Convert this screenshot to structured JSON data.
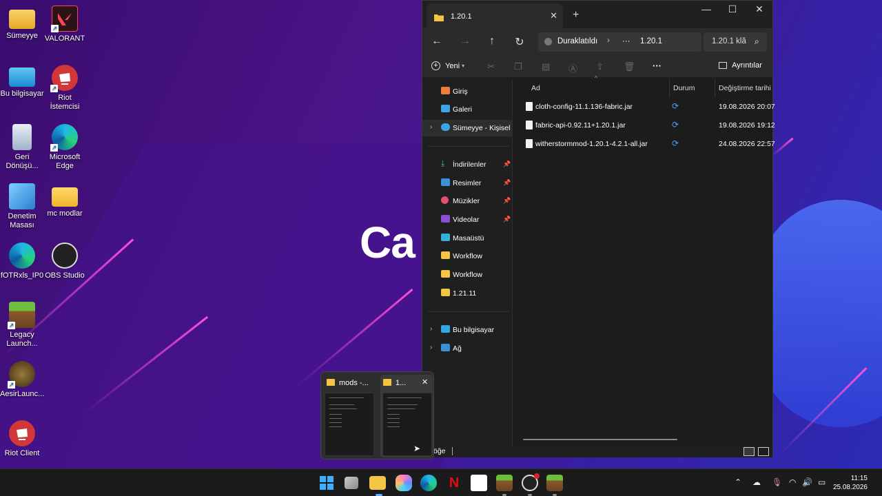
{
  "desktop": {
    "icons": [
      {
        "label": "Sümeyye"
      },
      {
        "label": "VALORANT"
      },
      {
        "label": "Bu bilgisayar"
      },
      {
        "label": "Riot İstemcisi"
      },
      {
        "label": "Geri Dönüşü..."
      },
      {
        "label": "Microsoft Edge"
      },
      {
        "label": "Denetim Masası"
      },
      {
        "label": "mc modlar"
      },
      {
        "label": "fOTRxls_IP0"
      },
      {
        "label": "OBS Studio"
      },
      {
        "label": "Legacy Launch..."
      },
      {
        "label": "AesirLaunc..."
      },
      {
        "label": "Riot Client"
      }
    ],
    "overlay_text": "Ca"
  },
  "explorer": {
    "tab_label": "1.20.1",
    "nav": {
      "address_prefix": "Duraklatıldı",
      "address_ellipsis": "···",
      "address_current": "1.20.1",
      "search_placeholder": "1.20.1 klă"
    },
    "toolbar": {
      "new_label": "Yeni",
      "more_label": "···",
      "details_label": "Ayrıntılar"
    },
    "sidebar": {
      "items": [
        {
          "label": "Giriş",
          "icon": "home-icon"
        },
        {
          "label": "Galeri",
          "icon": "gallery-icon"
        },
        {
          "label": "Sümeyye - Kişisel",
          "icon": "cloud-icon"
        },
        {
          "label": "İndirilenler",
          "icon": "download-icon"
        },
        {
          "label": "Resimler",
          "icon": "pictures-icon"
        },
        {
          "label": "Müzikler",
          "icon": "music-icon"
        },
        {
          "label": "Videolar",
          "icon": "video-icon"
        },
        {
          "label": "Masaüstü",
          "icon": "desktop-icon"
        },
        {
          "label": "Workflow",
          "icon": "folder-icon"
        },
        {
          "label": "Workflow",
          "icon": "folder-icon"
        },
        {
          "label": "1.21.11",
          "icon": "folder-icon"
        },
        {
          "label": "Bu bilgisayar",
          "icon": "computer-icon"
        },
        {
          "label": "Ağ",
          "icon": "network-icon"
        }
      ]
    },
    "columns": {
      "name": "Ad",
      "status": "Durum",
      "modified": "Değiştirme tarihi"
    },
    "files": [
      {
        "name": "cloth-config-11.1.136-fabric.jar",
        "date": "19.08.2026 20:07"
      },
      {
        "name": "fabric-api-0.92.11+1.20.1.jar",
        "date": "19.08.2026 19:12"
      },
      {
        "name": "witherstormmod-1.20.1-4.2.1-all.jar",
        "date": "24.08.2026 22:57"
      }
    ],
    "statusbar_text": "öğe"
  },
  "preview": {
    "items": [
      {
        "label": "mods -..."
      },
      {
        "label": "1..."
      }
    ]
  },
  "taskbar": {
    "time": "11:15",
    "date": "25.08.2026"
  },
  "colors": {
    "accent": "#4ea0ff",
    "folder": "#f4c542",
    "window_bg": "#1f1f1f"
  }
}
